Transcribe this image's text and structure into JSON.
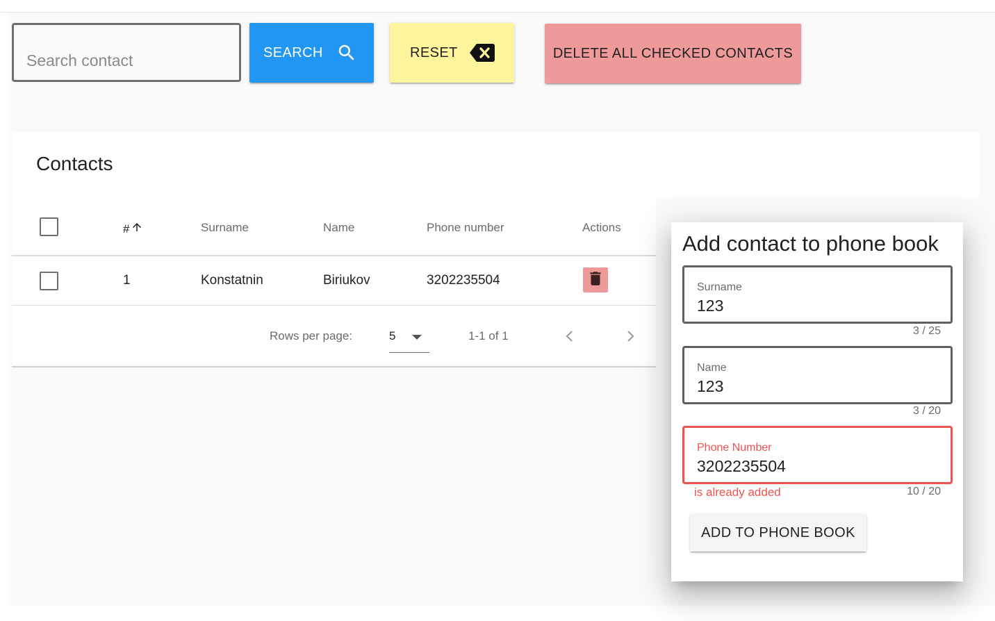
{
  "toolbar": {
    "search_placeholder": "Search contact",
    "search_value": "",
    "search_label": "SEARCH",
    "reset_label": "RESET",
    "delete_all_label": "DELETE ALL CHECKED CONTACTS"
  },
  "contacts": {
    "title": "Contacts",
    "columns": [
      "#",
      "Surname",
      "Name",
      "Phone number",
      "Actions"
    ],
    "sort_icon": "arrow-up-icon",
    "rows": [
      {
        "index": "1",
        "surname": "Konstatnin",
        "name": "Biriukov",
        "phone": "3202235504",
        "checked": false
      }
    ],
    "footer": {
      "rows_per_page_label": "Rows per page:",
      "rows_per_page_value": "5",
      "range_text": "1-1 of 1"
    }
  },
  "dialog": {
    "title": "Add contact to phone book",
    "fields": [
      {
        "label": "Surname",
        "value": "123",
        "counter": "3 / 25",
        "error": ""
      },
      {
        "label": "Name",
        "value": "123",
        "counter": "3 / 20",
        "error": ""
      },
      {
        "label": "Phone Number",
        "value": "3202235504",
        "counter": "10 / 20",
        "error": "is already added"
      }
    ],
    "submit_label": "ADD TO PHONE BOOK"
  },
  "colors": {
    "search_button": "#2196f3",
    "reset_button": "#fff59d",
    "delete_button": "#ef9a9a",
    "error": "#ef5350"
  }
}
